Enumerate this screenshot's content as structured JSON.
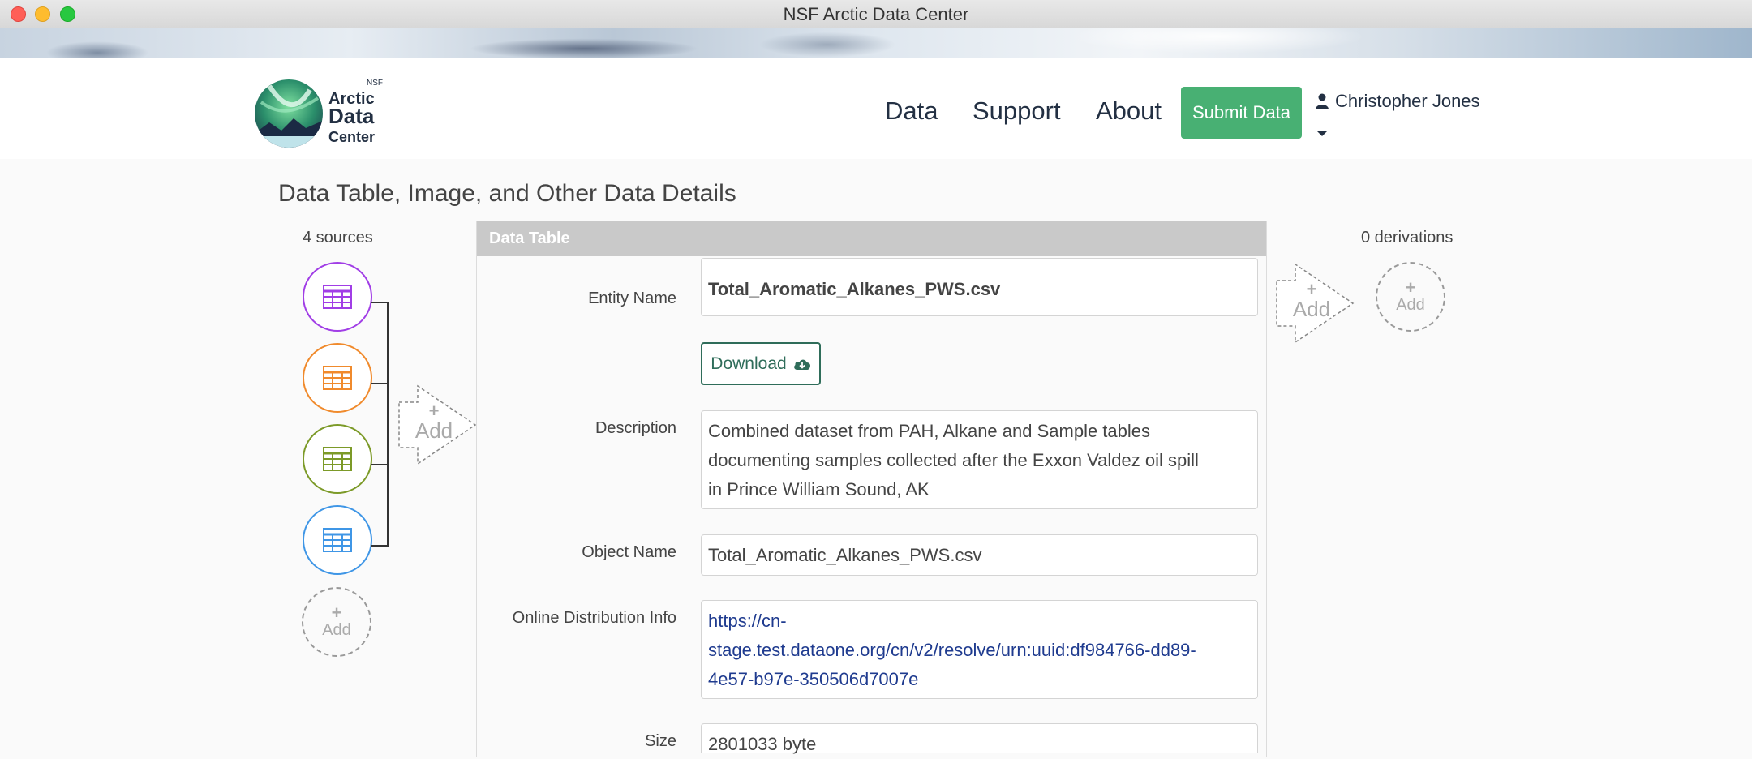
{
  "window": {
    "title": "NSF Arctic Data Center"
  },
  "header": {
    "logo": {
      "small": "NSF",
      "line1": "Arctic",
      "line2": "Data",
      "line3": "Center"
    },
    "nav": [
      "Data",
      "Support",
      "About"
    ],
    "submit_label": "Submit Data",
    "user_name": "Christopher Jones"
  },
  "page": {
    "heading": "Data Table, Image, and Other Data Details"
  },
  "sources": {
    "count_label": "4 sources",
    "colors": [
      "#a13ee6",
      "#f08a2c",
      "#7c9a28",
      "#3f96e6"
    ],
    "add_label": "Add",
    "arrow_add_label": "Add"
  },
  "derivations": {
    "count_label": "0 derivations",
    "add_label": "Add",
    "arrow_add_label": "Add"
  },
  "panel": {
    "header": "Data Table",
    "download_label": "Download",
    "fields": {
      "entity_name": {
        "label": "Entity Name",
        "value": "Total_Aromatic_Alkanes_PWS.csv"
      },
      "description": {
        "label": "Description",
        "line1": "Combined dataset from PAH, Alkane and Sample tables",
        "line2": "documenting samples collected after the Exxon Valdez oil spill",
        "line3": "in Prince William Sound, AK"
      },
      "object_name": {
        "label": "Object Name",
        "value": "Total_Aromatic_Alkanes_PWS.csv"
      },
      "online_distribution": {
        "label": "Online Distribution Info",
        "line1": "https://cn-",
        "line2": "stage.test.dataone.org/cn/v2/resolve/urn:uuid:df984766-dd89-",
        "line3": "4e57-b97e-350506d7007e"
      },
      "size": {
        "label": "Size",
        "value": "2801033 byte"
      }
    }
  }
}
